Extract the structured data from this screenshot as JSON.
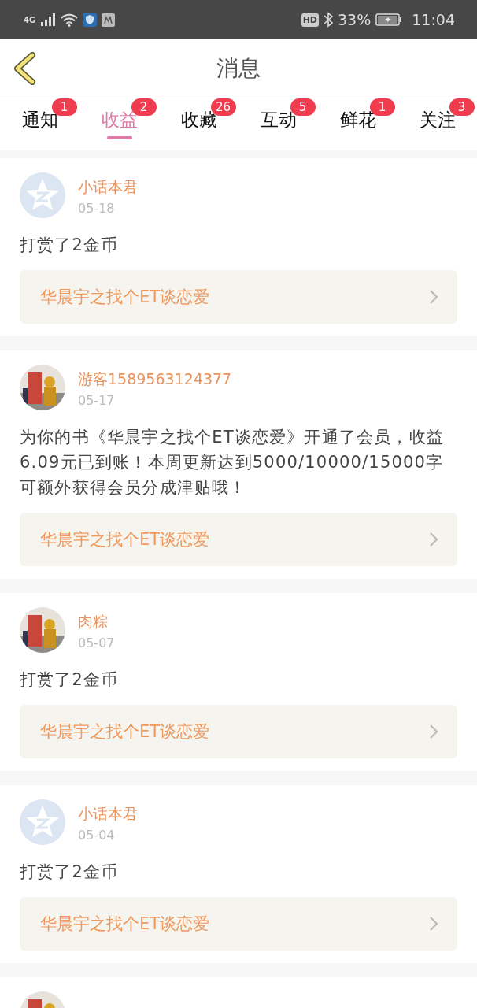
{
  "status_bar": {
    "network": "4G",
    "hd": "HD",
    "battery": "33%",
    "time": "11:04"
  },
  "header": {
    "title": "消息"
  },
  "tabs": [
    {
      "label": "通知",
      "badge": "1",
      "selected": false
    },
    {
      "label": "收益",
      "badge": "2",
      "selected": true
    },
    {
      "label": "收藏",
      "badge": "26",
      "selected": false
    },
    {
      "label": "互动",
      "badge": "5",
      "selected": false
    },
    {
      "label": "鲜花",
      "badge": "1",
      "selected": false
    },
    {
      "label": "关注",
      "badge": "3",
      "selected": false
    }
  ],
  "messages": [
    {
      "avatar": {
        "kind": "default"
      },
      "name": "小话本君",
      "date": "05-18",
      "text": "打赏了2金币",
      "book": "华晨宇之找个ET谈恋爱"
    },
    {
      "avatar": {
        "kind": "picture"
      },
      "name": "游客1589563124377",
      "date": "05-17",
      "text": "为你的书《华晨宇之找个ET谈恋爱》开通了会员，收益6.09元已到账！本周更新达到5000/10000/15000字可额外获得会员分成津贴哦！",
      "book": "华晨宇之找个ET谈恋爱"
    },
    {
      "avatar": {
        "kind": "picture"
      },
      "name": "肉粽",
      "date": "05-07",
      "text": "打赏了2金币",
      "book": "华晨宇之找个ET谈恋爱"
    },
    {
      "avatar": {
        "kind": "default"
      },
      "name": "小话本君",
      "date": "05-04",
      "text": "打赏了2金币",
      "book": "华晨宇之找个ET谈恋爱"
    },
    {
      "avatar": {
        "kind": "picture"
      }
    }
  ]
}
